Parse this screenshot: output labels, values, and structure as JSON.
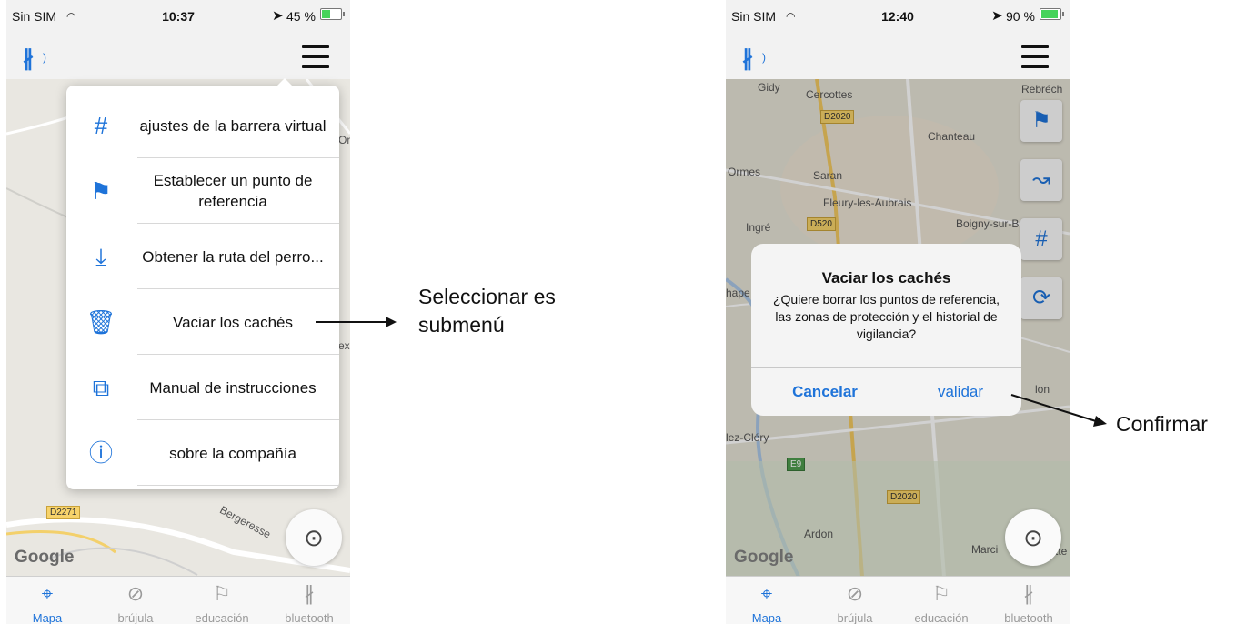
{
  "phone1": {
    "status": {
      "carrier": "Sin SIM",
      "time": "10:37",
      "battery": "45 %",
      "battery_level": 0.45
    },
    "menu_items": [
      {
        "icon": "fence-icon",
        "label": "ajustes de la barrera virtual"
      },
      {
        "icon": "flag-icon",
        "label": "Establecer un punto de referencia"
      },
      {
        "icon": "download-icon",
        "label": "Obtener la ruta del perro..."
      },
      {
        "icon": "trash-icon",
        "label": "Vaciar los cachés"
      },
      {
        "icon": "manual-icon",
        "label": "Manual de instrucciones"
      },
      {
        "icon": "info-icon",
        "label": "sobre la compañía"
      }
    ],
    "map_labels": [
      "Orl",
      "D2271",
      "expr",
      "Bergeresse"
    ]
  },
  "phone2": {
    "status": {
      "carrier": "Sin SIM",
      "time": "12:40",
      "battery": "90 %",
      "battery_level": 0.9
    },
    "map_labels": [
      "Gidy",
      "Cercottes",
      "Rebréch",
      "D2020",
      "Chanteau",
      "Ormes",
      "Saran",
      "Fleury-les-Aubrais",
      "Ingré",
      "D520",
      "Boigny-sur-B",
      "hape",
      "lez-Cléry",
      "E9",
      "D2020",
      "Ardon",
      "Marci",
      "lon",
      "tte"
    ],
    "dialog": {
      "title": "Vaciar los cachés",
      "message": "¿Quiere borrar los puntos de referencia, las zonas de protección y el historial de vigilancia?",
      "cancel": "Cancelar",
      "confirm": "validar"
    }
  },
  "common": {
    "google": "Google",
    "tabs": [
      {
        "icon": "map-pin-icon",
        "label": "Mapa"
      },
      {
        "icon": "compass-icon",
        "label": "brújula"
      },
      {
        "icon": "flag-outline-icon",
        "label": "educación"
      },
      {
        "icon": "bluetooth-icon",
        "label": "bluetooth"
      }
    ]
  },
  "annotations": {
    "left": "Seleccionar es submenú",
    "right": "Confirmar"
  },
  "colors": {
    "accent": "#1e73d9",
    "battery": "#45d35a"
  }
}
